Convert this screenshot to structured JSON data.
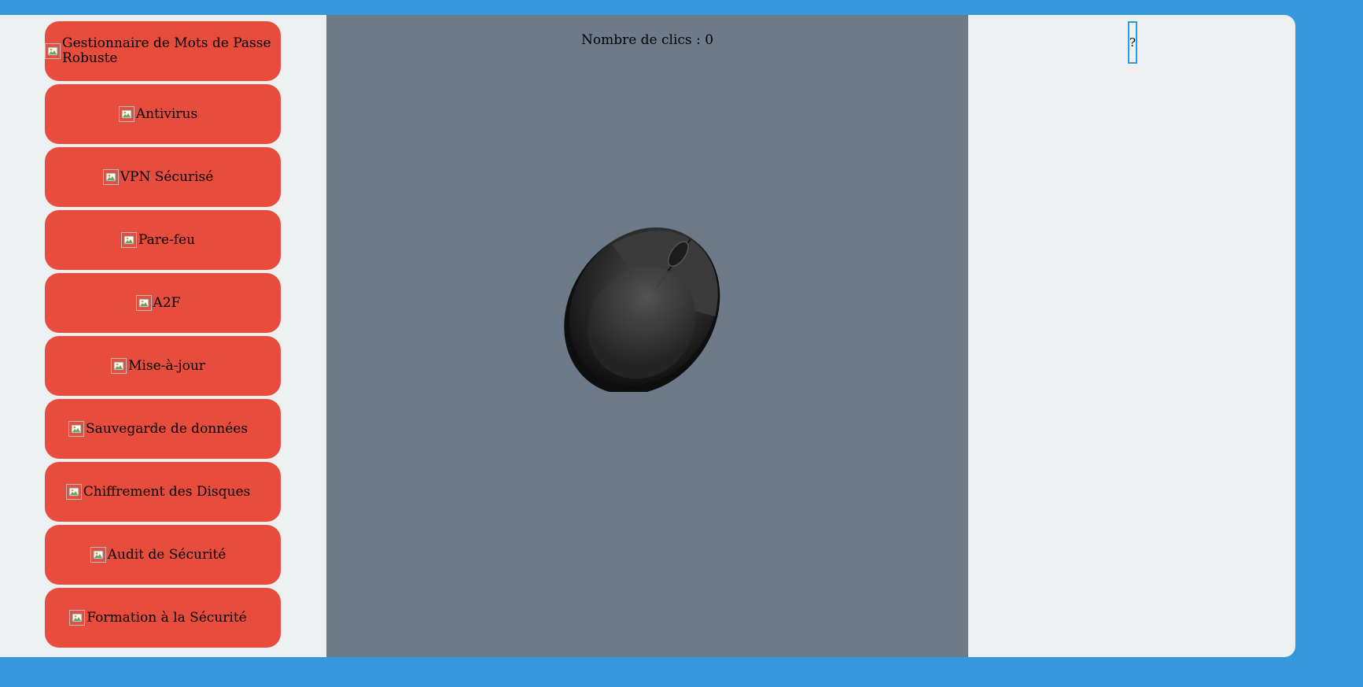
{
  "counter": {
    "text": "Nombre de clics : 0"
  },
  "help": {
    "label": "?"
  },
  "upgrades": [
    {
      "label": "Gestionnaire de Mots de Passe Robuste",
      "icon": "broken-image-icon"
    },
    {
      "label": "Antivirus",
      "icon": "broken-image-icon"
    },
    {
      "label": "VPN Sécurisé",
      "icon": "broken-image-icon"
    },
    {
      "label": "Pare-feu",
      "icon": "broken-image-icon"
    },
    {
      "label": "A2F",
      "icon": "broken-image-icon"
    },
    {
      "label": "Mise-à-jour",
      "icon": "broken-image-icon"
    },
    {
      "label": "Sauvegarde de données",
      "icon": "broken-image-icon"
    },
    {
      "label": "Chiffrement des Disques",
      "icon": "broken-image-icon"
    },
    {
      "label": "Audit de Sécurité",
      "icon": "broken-image-icon"
    },
    {
      "label": "Formation à la Sécurité",
      "icon": "broken-image-icon"
    }
  ],
  "colors": {
    "background": "#3498db",
    "panel": "#ecf0f1",
    "button": "#e74c3c",
    "main": "#6c7a89"
  }
}
